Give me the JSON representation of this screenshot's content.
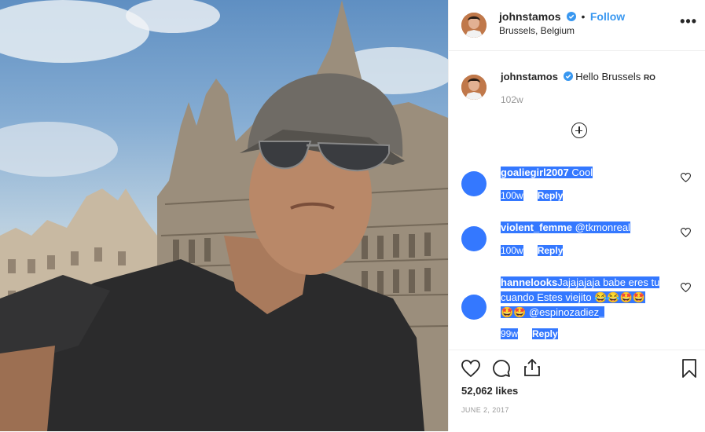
{
  "header": {
    "username": "johnstamos",
    "follow_label": "Follow",
    "location": "Brussels, Belgium",
    "more_icon": "•••"
  },
  "caption": {
    "username": "johnstamos",
    "text": "Hello Brussels",
    "tag": "RO",
    "time": "102w"
  },
  "comments": [
    {
      "username": "goaliegirl2007",
      "text": "Cool",
      "time": "100w",
      "reply": "Reply"
    },
    {
      "username": "violent_femme",
      "text": "@tkmonreal",
      "time": "100w",
      "reply": "Reply"
    },
    {
      "username": "hannelooks",
      "text": "Jajajajaja babe eres tu cuando Estes viejito 😂😂🤩🤩",
      "text2": "🤩🤩 @espinozadiez_",
      "time": "99w",
      "reply": "Reply"
    }
  ],
  "footer": {
    "likes": "52,062 likes",
    "date": "JUNE 2, 2017"
  },
  "colors": {
    "accent": "#3897f0",
    "selection": "#3478ff"
  }
}
